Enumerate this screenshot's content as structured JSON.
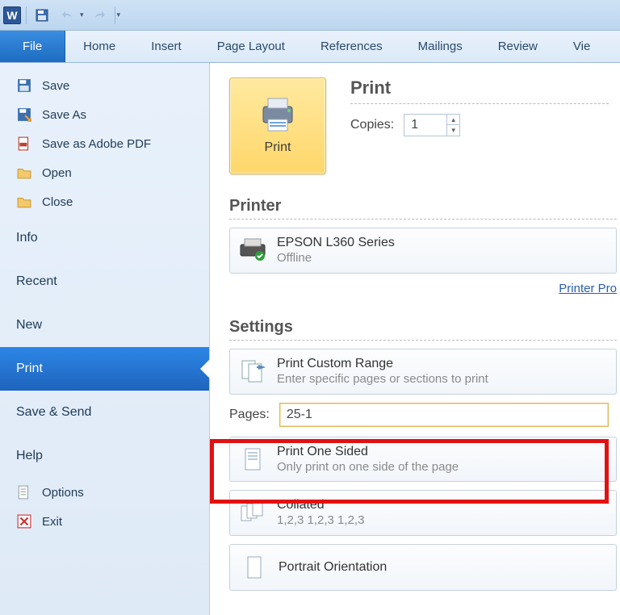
{
  "titlebar": {
    "app_logo_letter": "W"
  },
  "ribbon": {
    "tabs": [
      "File",
      "Home",
      "Insert",
      "Page Layout",
      "References",
      "Mailings",
      "Review",
      "Vie"
    ]
  },
  "sidebar": {
    "items": [
      {
        "label": "Save"
      },
      {
        "label": "Save As"
      },
      {
        "label": "Save as Adobe PDF"
      },
      {
        "label": "Open"
      },
      {
        "label": "Close"
      },
      {
        "label": "Info"
      },
      {
        "label": "Recent"
      },
      {
        "label": "New"
      },
      {
        "label": "Print"
      },
      {
        "label": "Save & Send"
      },
      {
        "label": "Help"
      },
      {
        "label": "Options"
      },
      {
        "label": "Exit"
      }
    ]
  },
  "print_panel": {
    "print_button_label": "Print",
    "heading": "Print",
    "copies_label": "Copies:",
    "copies_value": "1",
    "printer_heading": "Printer",
    "printer_name": "EPSON L360 Series",
    "printer_status": "Offline",
    "printer_properties_label": "Printer Pro",
    "settings_heading": "Settings",
    "setting_range_title": "Print Custom Range",
    "setting_range_sub": "Enter specific pages or sections to print",
    "pages_label": "Pages:",
    "pages_value": "25-1",
    "setting_sides_title": "Print One Sided",
    "setting_sides_sub": "Only print on one side of the page",
    "setting_collate_title": "Collated",
    "setting_collate_sub": "1,2,3    1,2,3    1,2,3",
    "setting_orient_title": "Portrait Orientation"
  }
}
